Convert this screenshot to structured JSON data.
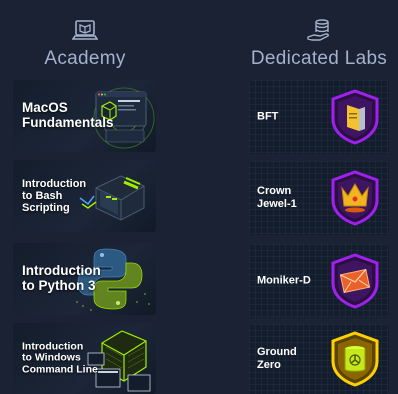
{
  "academy": {
    "title": "Academy",
    "cards": [
      {
        "title": "MacOS\nFundamentals"
      },
      {
        "title": "Introduction\nto Bash\nScripting"
      },
      {
        "title": "Introduction\nto Python 3"
      },
      {
        "title": "Introduction\nto Windows\nCommand Line"
      }
    ]
  },
  "labs": {
    "title": "Dedicated Labs",
    "cards": [
      {
        "title": "BFT"
      },
      {
        "title": "Crown\nJewel-1"
      },
      {
        "title": "Moniker-D"
      },
      {
        "title": "Ground\nZero"
      }
    ]
  },
  "colors": {
    "background": "#1a2233",
    "heading": "#a4b1cd",
    "accent_green": "#9fef00",
    "badge_purple": "#a020f0",
    "badge_yellow": "#ffd000"
  }
}
